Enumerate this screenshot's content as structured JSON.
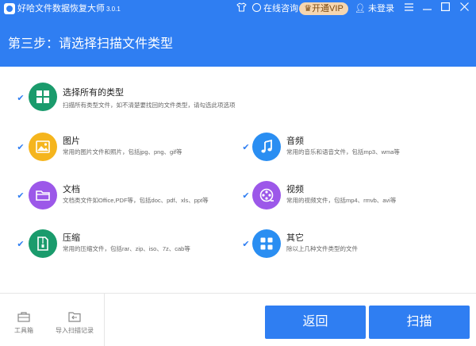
{
  "titlebar": {
    "app_name": "好哈文件数据恢复大师",
    "version": "3.0.1",
    "consult_label": "在线咨询",
    "vip_label": "开通VIP",
    "login_label": "未登录",
    "shirt_icon": "shirt-icon",
    "menu_icon": "menu-icon",
    "minimize_icon": "minimize-icon",
    "maximize_icon": "maximize-icon",
    "close_icon": "close-icon"
  },
  "step": {
    "title": "第三步：请选择扫描文件类型"
  },
  "select_all": {
    "name": "选择所有的类型",
    "desc": "扫描所有类型文件，如不清楚要找回的文件类型，请勾选此项选项",
    "checked": true,
    "color": "#1a9b6c"
  },
  "categories": [
    {
      "key": "image",
      "name": "图片",
      "desc": "常用的图片文件和照片，包括jpg、png、gif等",
      "color": "#f5b51d",
      "checked": true
    },
    {
      "key": "audio",
      "name": "音频",
      "desc": "常用的音乐和语音文件，包括mp3、wma等",
      "color": "#2a8ef2",
      "checked": true
    },
    {
      "key": "document",
      "name": "文档",
      "desc": "文档类文件如Office,PDF等，包括doc、pdf、xls、ppt等",
      "color": "#9c58e9",
      "checked": true
    },
    {
      "key": "video",
      "name": "视频",
      "desc": "常用的视频文件，包括mp4、rmvb、avi等",
      "color": "#9c58e9",
      "checked": true
    },
    {
      "key": "archive",
      "name": "压缩",
      "desc": "常用的压缩文件，包括rar、zip、iso、7z、cab等",
      "color": "#1a9b6c",
      "checked": true
    },
    {
      "key": "other",
      "name": "其它",
      "desc": "除以上几种文件类型的文件",
      "color": "#2a8ef2",
      "checked": true
    }
  ],
  "footer": {
    "toolbox_label": "工具箱",
    "import_label": "导入扫描记录",
    "back_label": "返回",
    "scan_label": "扫描"
  },
  "colors": {
    "accent": "#2f7ef2",
    "vip_bg": "#f6d6b0"
  }
}
